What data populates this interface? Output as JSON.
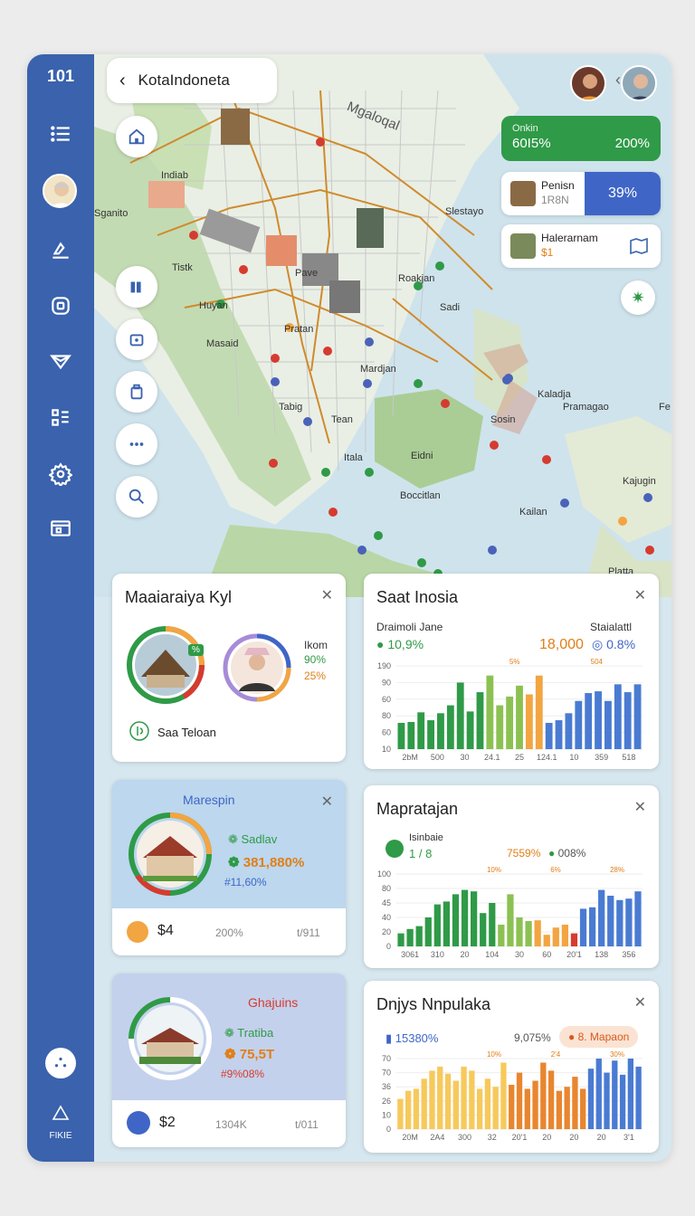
{
  "sidebar": {
    "top_label": "101",
    "bottom_label": "FIKIE",
    "icons": [
      "menu-icon",
      "pen-icon",
      "box-icon",
      "send-icon",
      "list-icon",
      "gear-icon",
      "window-icon"
    ]
  },
  "header": {
    "back_glyph": "‹",
    "title": "KotaIndoneta",
    "chevron": "‹"
  },
  "map": {
    "labels": {
      "region_title": "Mgaloqal",
      "l1": "Indiab",
      "l2": "Sganito",
      "l3": "Tistk",
      "l4": "Huyan",
      "l5": "Masaid",
      "l6": "Pave",
      "l7": "Pratan",
      "l8": "Slestayo",
      "l9": "Roakjan",
      "l10": "Sadi",
      "l11": "Mardjan",
      "l12": "Kaladja",
      "l13": "Pramagao",
      "l14": "Fe",
      "l15": "Tabig",
      "l16": "Tean",
      "l17": "Sosin",
      "l18": "Itala",
      "l19": "Eidni",
      "l20": "Boccitlan",
      "l21": "Kailan",
      "l22": "Kajugin",
      "l23": "Platta"
    }
  },
  "stats": {
    "green": {
      "label": "Onkin",
      "left": "60I5%",
      "right": "200%"
    },
    "card1": {
      "title": "Penisn",
      "sub": "1R8N",
      "value": "39%"
    },
    "card2": {
      "title": "Halerarnam",
      "sub": "$1"
    }
  },
  "cards": {
    "c1": {
      "title": "Maaiaraiya Kyl",
      "side_label": "Ikom",
      "pct1": "90%",
      "pct2": "25%",
      "footer": "Saa Teloan"
    },
    "c2": {
      "title": "Saat Inosia",
      "left_label": "Draimoli Jane",
      "left_value": "10,9%",
      "mid_value": "18,000",
      "right_label": "Staialattl",
      "right_value": "0.8%",
      "chart_data": {
        "type": "bar",
        "ylim": [
          0,
          190
        ],
        "yticks": [
          "190",
          "90",
          "60",
          "80",
          "60",
          "10"
        ],
        "xticks": [
          "2bM",
          "500",
          "30",
          "24.1",
          "25",
          "124.1",
          "10",
          "359",
          "518"
        ],
        "annotations": [
          "5%",
          "504"
        ],
        "series": [
          {
            "color": "#2f9a47",
            "values": [
              60,
              62,
              84,
              66,
              82,
              100,
              152,
              86,
              130
            ]
          },
          {
            "color": "#8cc152",
            "values": [
              168,
              100,
              120,
              145
            ]
          },
          {
            "color": "#f2a541",
            "values": [
              125,
              168
            ]
          },
          {
            "color": "#4a7bd2",
            "values": [
              60,
              66,
              82,
              110,
              128,
              132,
              110,
              148,
              130,
              148
            ]
          }
        ]
      }
    },
    "c3": {
      "title": "Marespin",
      "line1": "Sadlav",
      "line2": "381,880%",
      "line3": "#11,60%",
      "footer_value": "$4",
      "footer_mid": "200%",
      "footer_right": "t/911"
    },
    "c4": {
      "title": "Mapratajan",
      "left_label": "Isinbaie",
      "left_value": "1 / 8",
      "mid_value": "7559%",
      "right_value": "008%",
      "chart_data": {
        "type": "bar",
        "ylim": [
          0,
          100
        ],
        "yticks": [
          "100",
          "80",
          "45",
          "40",
          "20",
          "0"
        ],
        "xticks": [
          "3061",
          "310",
          "20",
          "104",
          "30",
          "60",
          "20'1",
          "138",
          "356"
        ],
        "annotations": [
          "10%",
          "6%",
          "28%"
        ],
        "series": [
          {
            "color": "#2f9a47",
            "values": [
              18,
              24,
              28,
              40,
              58,
              62,
              72,
              78,
              76,
              46,
              60
            ]
          },
          {
            "color": "#8cc152",
            "values": [
              30,
              72,
              40,
              35
            ]
          },
          {
            "color": "#f2a541",
            "values": [
              36,
              16,
              26,
              30
            ]
          },
          {
            "color": "#d63b2f",
            "values": [
              18
            ]
          },
          {
            "color": "#4a7bd2",
            "values": [
              52,
              54,
              78,
              70,
              64,
              66,
              76
            ]
          }
        ]
      }
    },
    "c5": {
      "title": "Ghajuins",
      "line1": "Tratiba",
      "line2": "75,5T",
      "line3": "#9%08%",
      "footer_value": "$2",
      "footer_mid": "1304K",
      "footer_right": "t/011"
    },
    "c6": {
      "title": "Dnjys Nnpulaka",
      "left_value": "15380%",
      "mid_value": "9,075%",
      "pill": "8. Mapaon",
      "chart_data": {
        "type": "bar",
        "ylim": [
          0,
          70
        ],
        "yticks": [
          "70",
          "70",
          "36",
          "26",
          "10",
          "0"
        ],
        "xticks": [
          "20M",
          "2A4",
          "300",
          "32",
          "20'1",
          "20",
          "20",
          "20",
          "3'1"
        ],
        "annotations": [
          "10%",
          "2'4",
          "30%"
        ],
        "series": [
          {
            "color": "#f7c95c",
            "values": [
              30,
              38,
              40,
              50,
              58,
              62,
              55,
              48,
              62,
              58,
              40,
              50,
              42,
              66
            ]
          },
          {
            "color": "#e8862f",
            "values": [
              44,
              56,
              40,
              48,
              66,
              58,
              38,
              42,
              52,
              40
            ]
          },
          {
            "color": "#4a7bd2",
            "values": [
              60,
              70,
              56,
              68,
              54,
              70,
              62
            ]
          }
        ]
      }
    }
  }
}
